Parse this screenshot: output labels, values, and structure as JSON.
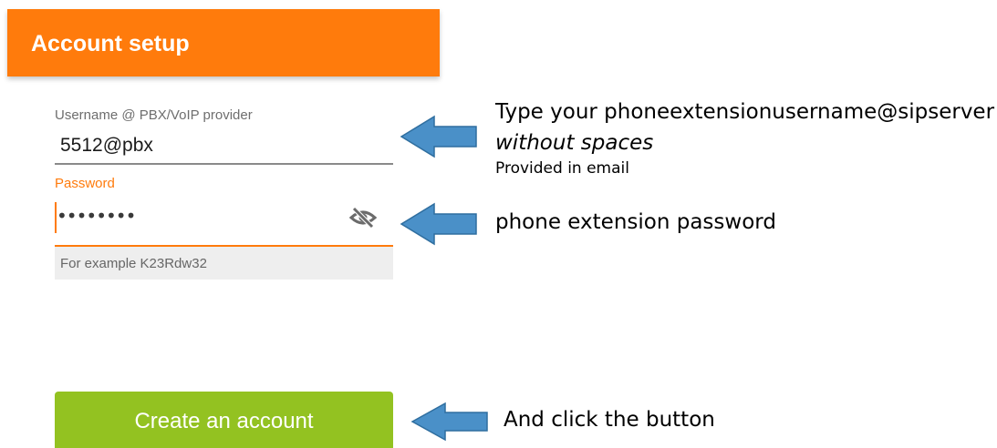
{
  "header": {
    "title": "Account setup",
    "color": "#ff7b0c"
  },
  "form": {
    "username": {
      "label": "Username @ PBX/VoIP provider",
      "value": "5512@pbx"
    },
    "password": {
      "label": "Password",
      "masked_value": "••••••••",
      "toggle_icon": "eye-off-icon",
      "hint": "For example K23Rdw32",
      "accent_color": "#ff7b0c"
    },
    "submit": {
      "label": "Create an account",
      "color": "#93c221"
    }
  },
  "annotations": {
    "arrow_color": "#4a90c8",
    "username_note_line1": "Type your phoneextensionusername@sipserver",
    "username_note_line2": "without spaces",
    "username_note_line3": "Provided in email",
    "password_note": "phone extension password",
    "button_note": "And click the button"
  }
}
